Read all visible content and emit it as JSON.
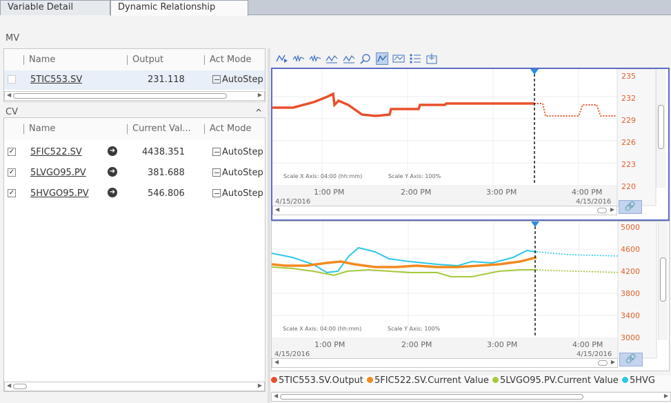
{
  "tabs": [
    {
      "label": "Variable Detail"
    },
    {
      "label": "Dynamic Relationship"
    }
  ],
  "mv": {
    "section_label": "MV",
    "columns": [
      "Name",
      "Output",
      "Act Mode"
    ],
    "rows": [
      {
        "name": "5TIC553.SV",
        "output": "231.118",
        "mode": "AutoStep"
      }
    ]
  },
  "cv": {
    "section_label": "CV",
    "collapse_glyph": "^",
    "columns": [
      "Name",
      "Current Val...",
      "Act Mode"
    ],
    "rows": [
      {
        "name": "5FIC522.SV",
        "value": "4438.351",
        "mode": "AutoStep",
        "checked": "✓"
      },
      {
        "name": "5LVGO95.PV",
        "value": "381.688",
        "mode": "AutoStep",
        "checked": "✓"
      },
      {
        "name": "5HVGO95.PV",
        "value": "546.806",
        "mode": "AutoStep",
        "checked": "✓"
      }
    ]
  },
  "toolbar": {
    "icons": [
      "trend-play-icon",
      "trend-step-1-icon",
      "trend-step-2-icon",
      "trend-step-3-icon",
      "trend-step-4-icon",
      "zoom-time-icon",
      "trend-fit-icon",
      "scale-icon",
      "legend-list-icon",
      "export-icon"
    ]
  },
  "charts": {
    "top": {
      "scale_x": "Scale X Axis:  04:00 (hh:mm)",
      "scale_y": "Scale Y Axis:  100%",
      "x_ticks": [
        "1:00 PM",
        "2:00 PM",
        "3:00 PM",
        "4:00 PM"
      ],
      "date_left": "4/15/2016",
      "date_right": "4/15/2016",
      "y_ticks": [
        "235",
        "232",
        "229",
        "226",
        "223",
        "220"
      ]
    },
    "bottom": {
      "scale_x": "Scale X Axis:  04:00 (hh:mm)",
      "scale_y": "Scale Y Axis:  100%",
      "x_ticks": [
        "1:00 PM",
        "2:00 PM",
        "3:00 PM",
        "4:00 PM"
      ],
      "date_left": "4/15/2016",
      "date_right": "4/15/2016",
      "y_ticks": [
        "5000",
        "4600",
        "4200",
        "3800",
        "3400",
        "3000"
      ]
    }
  },
  "legend": [
    {
      "label": "5TIC553.SV.Output",
      "color": "#e8502a"
    },
    {
      "label": "5FIC522.SV.Current Value",
      "color": "#f28a1e"
    },
    {
      "label": "5LVGO95.PV.Current Value",
      "color": "#a6c93a"
    },
    {
      "label": "5HVG",
      "color": "#2cc7e8"
    }
  ],
  "colors": {
    "mv_series": "#e8502a",
    "cv1": "#f28a1e",
    "cv2": "#a6c93a",
    "cv3": "#2cc7e8",
    "cursor_marker": "#2a8de0"
  }
}
